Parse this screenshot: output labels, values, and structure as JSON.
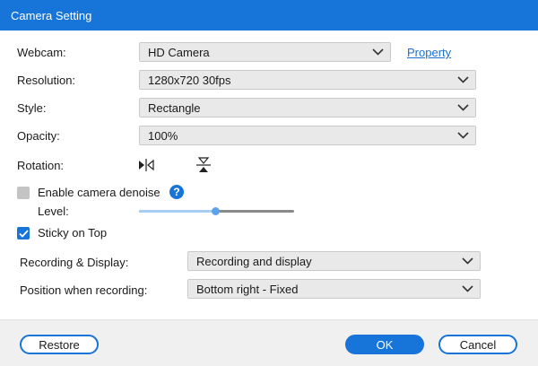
{
  "window": {
    "title": "Camera Setting"
  },
  "webcam": {
    "label": "Webcam:",
    "value": "HD Camera",
    "property_link": "Property"
  },
  "resolution": {
    "label": "Resolution:",
    "value": "1280x720 30fps"
  },
  "style": {
    "label": "Style:",
    "value": "Rectangle"
  },
  "opacity": {
    "label": "Opacity:",
    "value": "100%"
  },
  "rotation": {
    "label": "Rotation:",
    "icons": [
      "flip-horizontal-icon",
      "flip-vertical-icon"
    ]
  },
  "denoise": {
    "label": "Enable camera denoise",
    "checked": false,
    "level_label": "Level:",
    "level": 0.49,
    "help": "?"
  },
  "sticky": {
    "label": "Sticky on Top",
    "checked": true
  },
  "recording_display": {
    "label": "Recording & Display:",
    "value": "Recording and display"
  },
  "position": {
    "label": "Position when recording:",
    "value": "Bottom right - Fixed"
  },
  "footer": {
    "restore": "Restore",
    "ok": "OK",
    "cancel": "Cancel"
  },
  "colors": {
    "accent": "#1774d8",
    "link": "#1a6fd1",
    "dropdown_bg": "#e9e9e9"
  }
}
